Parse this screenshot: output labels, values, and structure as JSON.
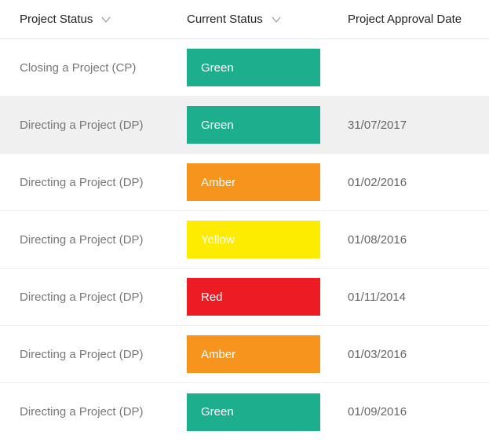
{
  "table": {
    "headers": {
      "project_status": "Project Status",
      "current_status": "Current Status",
      "approval_date": "Project Approval Date"
    },
    "status_colors": {
      "Green": "#1cae8d",
      "Amber": "#f7941d",
      "Yellow": "#fdeb00",
      "Red": "#ed1c24"
    },
    "rows": [
      {
        "project_status": "Closing a Project (CP)",
        "current_status": "Green",
        "approval_date": "",
        "selected": false
      },
      {
        "project_status": "Directing a Project (DP)",
        "current_status": "Green",
        "approval_date": "31/07/2017",
        "selected": true
      },
      {
        "project_status": "Directing a Project (DP)",
        "current_status": "Amber",
        "approval_date": "01/02/2016",
        "selected": false
      },
      {
        "project_status": "Directing a Project (DP)",
        "current_status": "Yellow",
        "approval_date": "01/08/2016",
        "selected": false
      },
      {
        "project_status": "Directing a Project (DP)",
        "current_status": "Red",
        "approval_date": "01/11/2014",
        "selected": false
      },
      {
        "project_status": "Directing a Project (DP)",
        "current_status": "Amber",
        "approval_date": "01/03/2016",
        "selected": false
      },
      {
        "project_status": "Directing a Project (DP)",
        "current_status": "Green",
        "approval_date": "01/09/2016",
        "selected": false
      }
    ]
  }
}
